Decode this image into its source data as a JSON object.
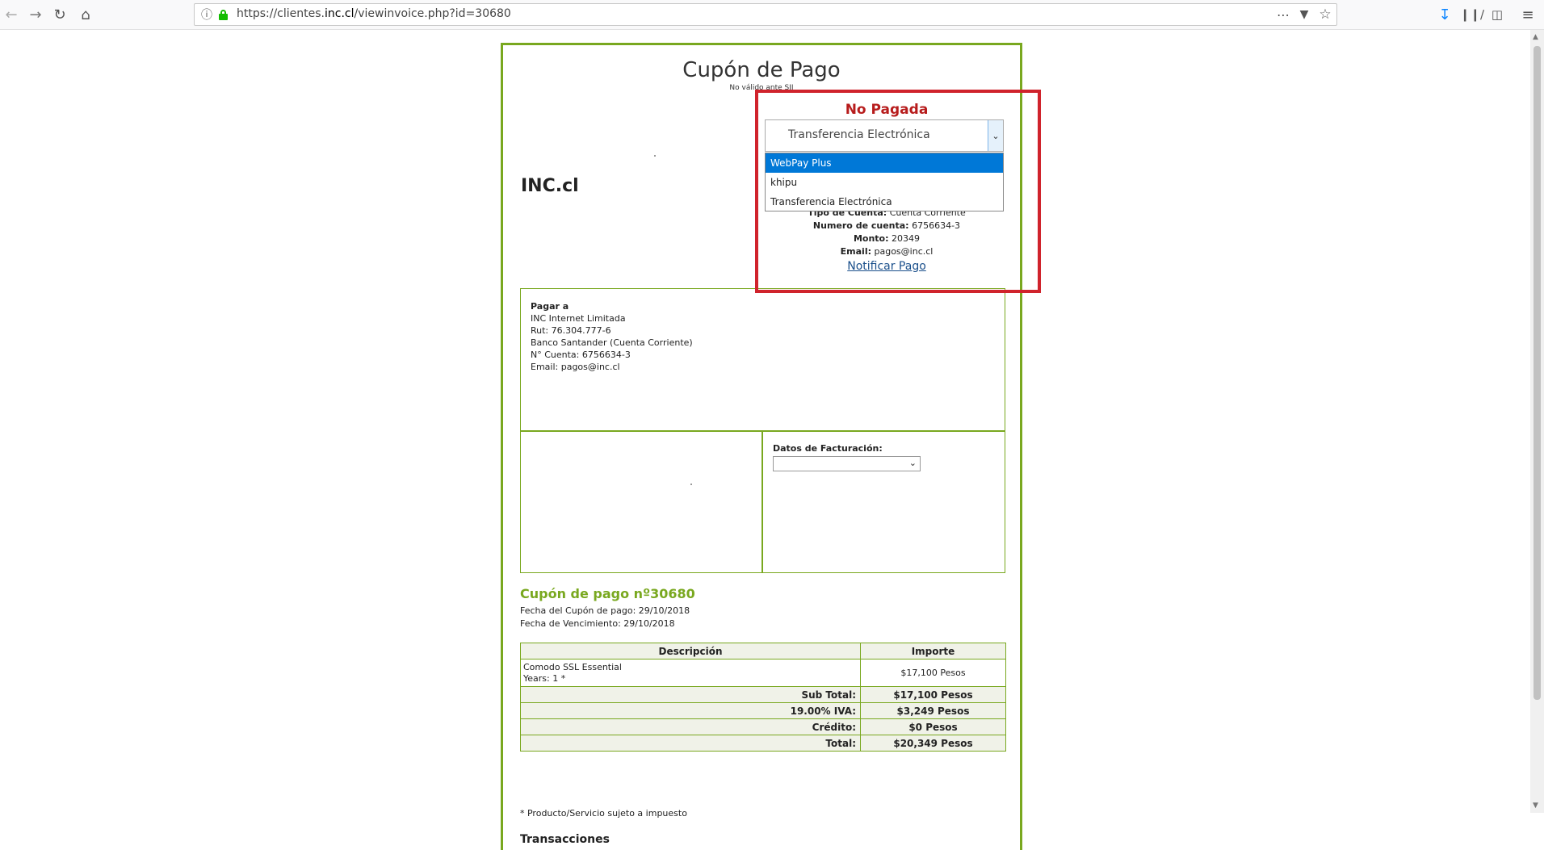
{
  "browser": {
    "url_prefix": "https://clientes.",
    "url_domain": "inc.cl",
    "url_suffix": "/viewinvoice.php?id=30680",
    "icons": [
      "back-icon",
      "forward-icon",
      "reload-icon",
      "home-icon",
      "info-icon",
      "lock-icon",
      "more-icon",
      "pocket-icon",
      "bookmark-star-icon",
      "download-icon",
      "library-icon",
      "sidebar-icon",
      "menu-icon"
    ]
  },
  "invoice": {
    "title": "Cupón de Pago",
    "subtitle": "No válido ante SII",
    "logo_text": "INC.cl",
    "status": "No Pagada",
    "payment_method": {
      "selected": "Transferencia Electrónica",
      "options": [
        "WebPay Plus",
        "khipu",
        "Transferencia Electrónica"
      ],
      "highlighted": "WebPay Plus"
    },
    "bank_details": {
      "account_type_label": "Tipo de Cuenta:",
      "account_type": "Cuenta Corriente",
      "account_number_label": "Numero de cuenta:",
      "account_number": "6756634-3",
      "amount_label": "Monto:",
      "amount": "20349",
      "email_label": "Email:",
      "email": "pagos@inc.cl",
      "notify_link": "Notificar Pago"
    },
    "pay_to": {
      "heading": "Pagar a",
      "lines": [
        "INC Internet Limitada",
        "Rut: 76.304.777-6",
        "Banco Santander (Cuenta Corriente)",
        "N° Cuenta: 6756634-3",
        "Email: pagos@inc.cl"
      ]
    },
    "billing": {
      "label": "Datos de Facturación:",
      "selected": ""
    },
    "number_heading": "Cupón de pago nº30680",
    "issue_date": "Fecha del Cupón de pago: 29/10/2018",
    "due_date": "Fecha de Vencimiento: 29/10/2018",
    "table": {
      "headers": [
        "Descripción",
        "Importe"
      ],
      "items": [
        {
          "line1": "Comodo SSL Essential",
          "line2": "Years: 1 *",
          "amount": "$17,100 Pesos"
        }
      ],
      "totals": [
        {
          "label": "Sub Total:",
          "value": "$17,100 Pesos"
        },
        {
          "label": "19.00% IVA:",
          "value": "$3,249 Pesos"
        },
        {
          "label": "Crédito:",
          "value": "$0 Pesos"
        },
        {
          "label": "Total:",
          "value": "$20,349 Pesos"
        }
      ]
    },
    "footnote": "* Producto/Servicio sujeto a impuesto",
    "transactions_heading": "Transacciones"
  },
  "colors": {
    "accent_green": "#79a81f",
    "status_red": "#b71c1c",
    "highlight_red": "#d0232c",
    "selection_blue": "#0078d7"
  }
}
